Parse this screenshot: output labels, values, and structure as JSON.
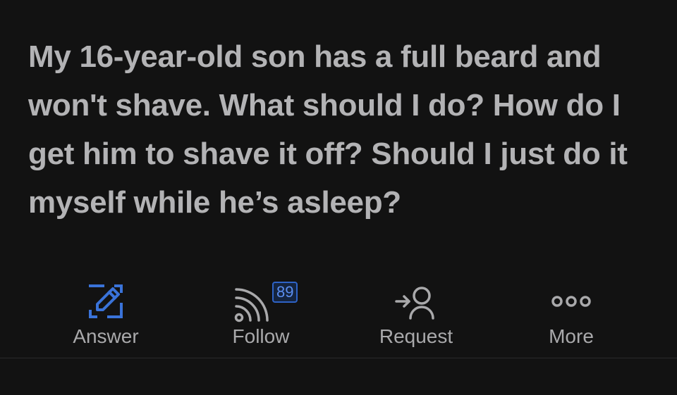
{
  "question": {
    "text": "My 16-year-old son has a full beard and won't shave. What should I do? How do I get him to shave it off? Should I just do it myself while he’s asleep?"
  },
  "actions": [
    {
      "label": "Answer",
      "icon": "edit-icon",
      "color": "#3a73d9"
    },
    {
      "label": "Follow",
      "icon": "rss-feed-icon",
      "badge": "89",
      "badge_color": "#2e63c7"
    },
    {
      "label": "Request",
      "icon": "request-user-icon"
    },
    {
      "label": "More",
      "icon": "more-dots-icon"
    }
  ],
  "footer": {
    "peek_text": ""
  },
  "colors": {
    "background": "#121212",
    "text": "#b3b3b5",
    "accent": "#3a73d9"
  }
}
